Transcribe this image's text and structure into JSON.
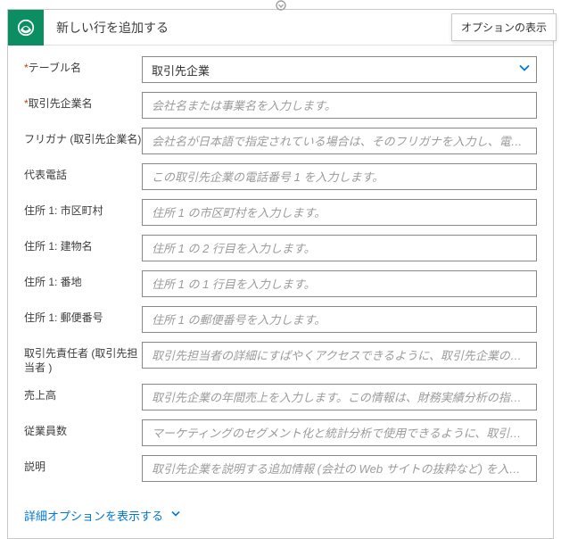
{
  "top_arrow_glyph": "⌄",
  "header": {
    "title": "新しい行を追加する",
    "tooltip": "オプションの表示",
    "icon_name": "dataverse-logo"
  },
  "fields": {
    "table_name": {
      "label": "テーブル名",
      "required": true,
      "value": "取引先企業"
    },
    "account_name": {
      "label": "取引先企業名",
      "required": true,
      "placeholder": "会社名または事業名を入力します。"
    },
    "furigana": {
      "label": "フリガナ (取引先企業名)",
      "required": false,
      "placeholder": "会社名が日本語で指定されている場合は、そのフリガナを入力し、電話などで"
    },
    "main_phone": {
      "label": "代表電話",
      "required": false,
      "placeholder": "この取引先企業の電話番号 1 を入力します。"
    },
    "city": {
      "label": "住所 1: 市区町村",
      "required": false,
      "placeholder": "住所 1 の市区町村を入力します。"
    },
    "building": {
      "label": "住所 1: 建物名",
      "required": false,
      "placeholder": "住所 1 の 2 行目を入力します。"
    },
    "street": {
      "label": "住所 1: 番地",
      "required": false,
      "placeholder": "住所 1 の 1 行目を入力します。"
    },
    "postal": {
      "label": "住所 1: 郵便番号",
      "required": false,
      "placeholder": "住所 1 の郵便番号を入力します。"
    },
    "contact": {
      "label": "取引先責任者 (取引先担当者 )",
      "required": false,
      "placeholder": "取引先担当者の詳細にすばやくアクセスできるように、取引先企業の取引先責"
    },
    "revenue": {
      "label": "売上高",
      "required": false,
      "placeholder": "取引先企業の年間売上を入力します。この情報は、財務実績分析の指標として"
    },
    "employees": {
      "label": "従業員数",
      "required": false,
      "placeholder": "マーケティングのセグメント化と統計分析で使用できるように、取引先企業で"
    },
    "description": {
      "label": "説明",
      "required": false,
      "placeholder": "取引先企業を説明する追加情報 (会社の Web サイトの抜粋など) を入力します"
    }
  },
  "advanced_link": "詳細オプションを表示する",
  "colors": {
    "brand": "#0b8f62",
    "link": "#0078d4",
    "required": "#d83b01"
  }
}
